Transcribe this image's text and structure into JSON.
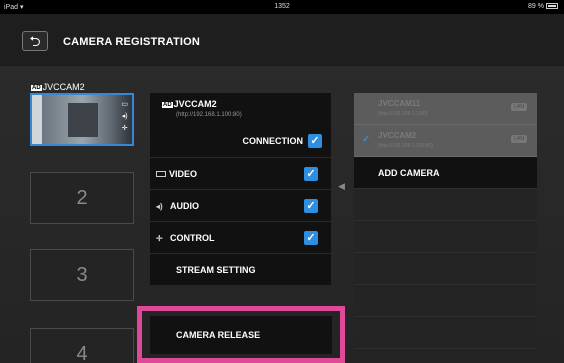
{
  "status_bar": {
    "device": "iPad",
    "time": "1352",
    "battery": "89 %"
  },
  "header": {
    "back_icon": "back-arrow-icon",
    "title": "CAMERA REGISTRATION"
  },
  "left_column": {
    "active_camera": {
      "badge": "AD",
      "name": "JVCCAM2"
    },
    "slots": [
      "2",
      "3",
      "4"
    ]
  },
  "camera_panel": {
    "badge": "AD",
    "name": "JVCCAM2",
    "url": "(http://192.168.1.100:80)",
    "connection_label": "CONNECTION",
    "options": [
      {
        "label": "VIDEO",
        "checked": true
      },
      {
        "label": "AUDIO",
        "checked": true
      },
      {
        "label": "CONTROL",
        "checked": true
      }
    ],
    "stream_setting_label": "STREAM SETTING"
  },
  "release_button": {
    "label": "CAMERA RELEASE"
  },
  "camera_list": {
    "items": [
      {
        "name": "JVCCAM11",
        "address": "(http://192.168.1.1:80)",
        "badge": "LAN",
        "checked": false
      },
      {
        "name": "JVCCAM2",
        "address": "(http://192.168.1.100:80)",
        "badge": "LAN",
        "checked": true
      }
    ],
    "add_camera_label": "ADD CAMERA"
  },
  "colors": {
    "accent": "#2e8fe0",
    "highlight": "#e0499a",
    "background": "#1c1c1c"
  }
}
